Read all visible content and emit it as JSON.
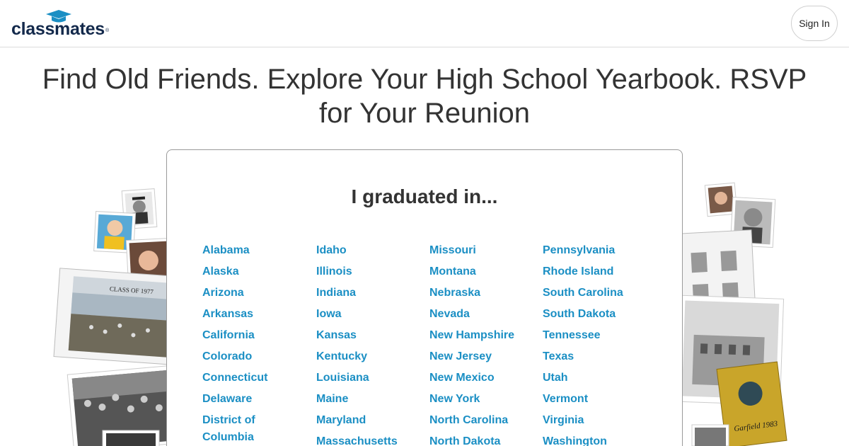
{
  "header": {
    "logo_text": "classmates",
    "logo_mark": "®",
    "signin_label": "Sign In"
  },
  "hero": {
    "headline": "Find Old Friends. Explore Your High School Yearbook. RSVP for Your Reunion"
  },
  "selector": {
    "title": "I graduated in...",
    "columns": [
      [
        "Alabama",
        "Alaska",
        "Arizona",
        "Arkansas",
        "California",
        "Colorado",
        "Connecticut",
        "Delaware",
        "District of Columbia"
      ],
      [
        "Idaho",
        "Illinois",
        "Indiana",
        "Iowa",
        "Kansas",
        "Kentucky",
        "Louisiana",
        "Maine",
        "Maryland",
        "Massachusetts"
      ],
      [
        "Missouri",
        "Montana",
        "Nebraska",
        "Nevada",
        "New Hampshire",
        "New Jersey",
        "New Mexico",
        "New York",
        "North Carolina",
        "North Dakota"
      ],
      [
        "Pennsylvania",
        "Rhode Island",
        "South Carolina",
        "South Dakota",
        "Tennessee",
        "Texas",
        "Utah",
        "Vermont",
        "Virginia",
        "Washington"
      ]
    ]
  },
  "collage": {
    "left_book_caption": "CLASS OF 1977",
    "right_yearbook_caption": "Garfield 1983"
  },
  "colors": {
    "link": "#1b8fc4",
    "logo": "#13294b",
    "cap": "#1b8fc4"
  }
}
